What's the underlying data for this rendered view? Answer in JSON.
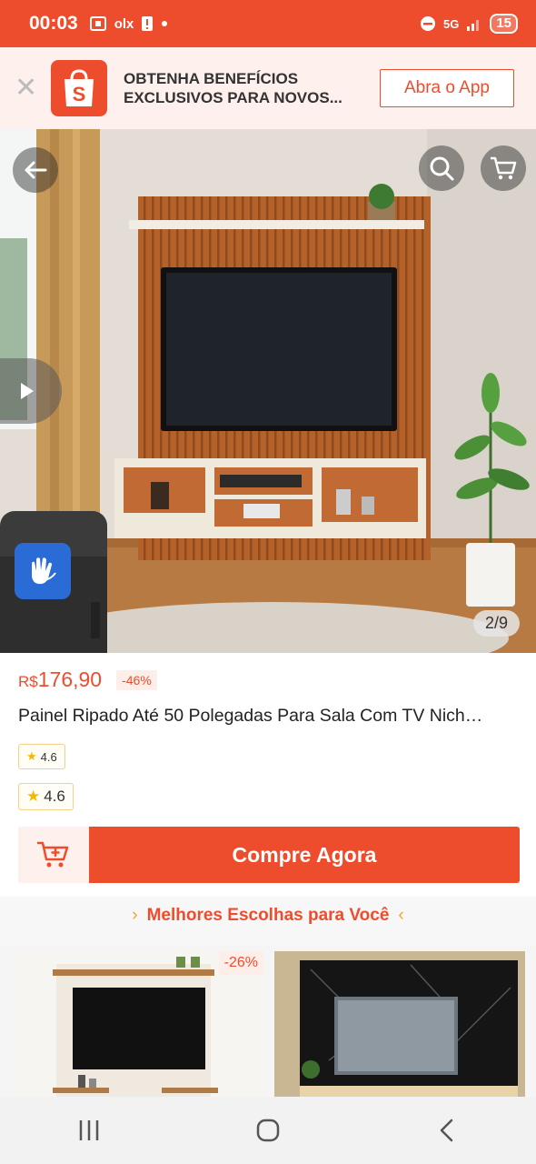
{
  "status_bar": {
    "time": "00:03",
    "olx_label": "olx",
    "network_label": "5G",
    "battery": "15"
  },
  "app_banner": {
    "text": "OBTENHA BENEFÍCIOS EXCLUSIVOS PARA NOVOS...",
    "open_app_label": "Abra o App",
    "close_icon": "close-icon",
    "logo_icon": "shopee-bag-icon"
  },
  "hero": {
    "page_indicator": "2/9",
    "back_icon": "arrow-left-icon",
    "search_icon": "search-icon",
    "cart_icon": "cart-icon",
    "video_icon": "play-icon",
    "accessibility_icon": "sign-language-icon"
  },
  "product": {
    "currency": "R$",
    "price": "176,90",
    "discount": "-46%",
    "title": "Painel Ripado Até 50 Polegadas Para Sala Com TV Nich…",
    "rating_small": "4.6",
    "rating_large": "4.6"
  },
  "buy_bar": {
    "cart_icon": "add-to-cart-icon",
    "buy_now_label": "Compre Agora"
  },
  "recommendations": {
    "title": "Melhores Escolhas para Você",
    "cards": [
      {
        "discount": "-26%"
      },
      {
        "discount": ""
      }
    ]
  },
  "nav_bar": {
    "recent_icon": "recent-apps-icon",
    "home_icon": "home-icon",
    "back_icon": "back-icon"
  },
  "colors": {
    "brand": "#ee4d2d",
    "banner_bg": "#fdf0ed",
    "star": "#f5b800"
  }
}
